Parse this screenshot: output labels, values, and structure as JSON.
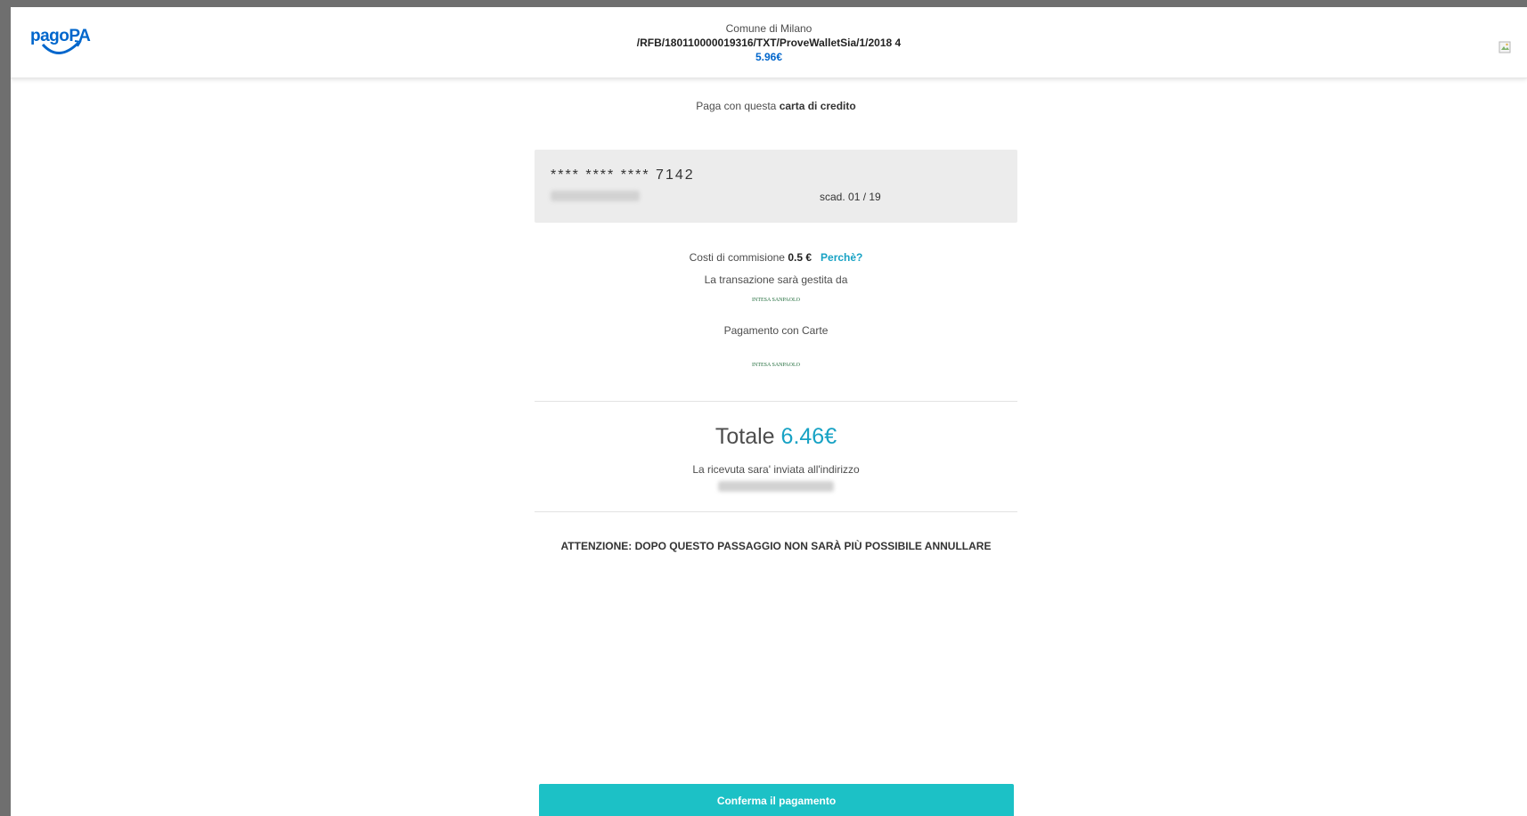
{
  "header": {
    "logo_text": "pagoPA",
    "organization": "Comune di Milano",
    "reference": "/RFB/180110000019316/TXT/ProveWalletSia/1/2018 4",
    "amount": "5.96€"
  },
  "payment": {
    "pay_with_prefix": "Paga con questa ",
    "pay_with_bold": "carta di credito",
    "card": {
      "number": "**** **** **** 7142",
      "expiry": "scad. 01 / 19"
    },
    "fee_prefix": "Costi di commisione ",
    "fee_amount": "0.5 €",
    "why_link": "Perchè?",
    "managed_by": "La transazione sarà gestita da",
    "bank_name": "INTESA SANPAOLO",
    "payment_method": "Pagamento con Carte",
    "bank_name_2": "INTESA SANPAOLO"
  },
  "summary": {
    "total_label": "Totale ",
    "total_amount": "6.46€",
    "receipt_text": "La ricevuta sara' inviata all'indirizzo"
  },
  "warning": "ATTENZIONE: DOPO QUESTO PASSAGGIO NON SARÀ PIÙ POSSIBILE ANNULLARE",
  "confirm_button": "Conferma il pagamento",
  "colors": {
    "accent": "#1cc1c6",
    "link": "#17a2c4",
    "brand": "#0066cc"
  }
}
